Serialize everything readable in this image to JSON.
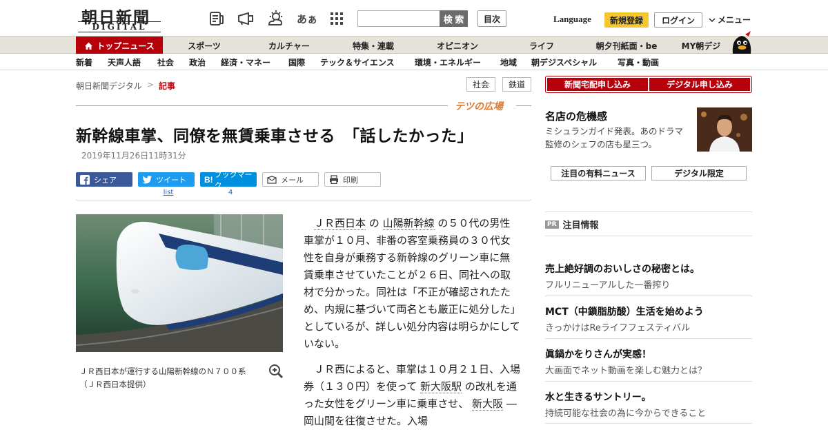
{
  "header": {
    "logo": "朝日新聞",
    "logo_sub": "DIGITAL",
    "search_placeholder": "",
    "search_button": "検 索",
    "toc_button": "目次",
    "language": "Language",
    "signup": "新規登録",
    "login": "ログイン",
    "menu": "メニュー",
    "icons": [
      "newspaper-icon",
      "megaphone-icon",
      "weather-icon",
      "font-size-icon",
      "grid-icon"
    ],
    "font_icon_text": "あぁ"
  },
  "nav_main": {
    "top": "トップニュース",
    "items": [
      "スポーツ",
      "カルチャー",
      "特集・連載",
      "オピニオン",
      "ライフ",
      "朝夕刊紙面・be",
      "MY朝デジ"
    ]
  },
  "nav_sub": [
    "新着",
    "天声人語",
    "社会",
    "政治",
    "経済・マネー",
    "国際",
    "テック＆サイエンス",
    "環境・エネルギー",
    "地域",
    "朝デジスペシャル",
    "写真・動画"
  ],
  "breadcrumb": {
    "home": "朝日新聞デジタル",
    "sep": ">",
    "current": "記事"
  },
  "tags": [
    "社会",
    "鉄道"
  ],
  "section_banner": "テツの広場",
  "article": {
    "title": "新幹線車掌、同僚を無賃乗車させる　「話したかった」",
    "date": "2019年11月26日11時31分",
    "share": {
      "facebook": "シェア",
      "twitter": "ツイート",
      "twitter_count": "list",
      "hatena": "ブックマーク",
      "hatena_count": "4",
      "mail": "メール",
      "print": "印刷"
    },
    "photo_caption": "ＪＲ西日本が運行する山陽新幹線のＮ７００系（ＪＲ西日本提供）",
    "p1": {
      "link1": "ＪＲ西日本",
      "mid1": " の ",
      "link2": "山陽新幹線",
      "rest": " の５０代の男性車掌が１０月、非番の客室乗務員の３０代女性を自身が乗務する新幹線のグリーン車に無賃乗車させていたことが２６日、同社への取材で分かった。同社は「不正が確認されたため、内規に基づいて両名とも厳正に処分した」としているが、詳しい処分内容は明らかにしていない。"
    },
    "p2": {
      "start": "ＪＲ西によると、車掌は１０月２１日、入場券（１３０円）を使って ",
      "link1": "新大阪駅",
      "mid1": " の改札を通った女性をグリーン車に乗車させ、 ",
      "link2": "新大阪",
      "rest": " ―岡山間を往復させた。入場"
    }
  },
  "sidebar": {
    "subscribe_print": "新聞宅配申し込み",
    "subscribe_digital": "デジタル申し込み",
    "promo_title": "名店の危機感",
    "promo_desc": "ミシュランガイド発表。あのドラマ監修のシェフの店も星三つ。",
    "pill_paid": "注目の有料ニュース",
    "pill_digital": "デジタル限定",
    "pr_badge": "PR",
    "pr_heading": "注目情報",
    "pr_items": [
      {
        "title": "売上絶好調のおいしさの秘密とは。",
        "sub": "フルリニューアルした一番搾り"
      },
      {
        "title": "MCT（中鎖脂肪酸）生活を始めよう",
        "sub": "きっかけはReライフフェスティバル"
      },
      {
        "title": "眞鍋かをりさんが実感！",
        "sub": "大画面でネット動画を楽しむ魅力とは？"
      },
      {
        "title": "水と生きるサントリー。",
        "sub": "持続可能な社会の為に今からできること"
      }
    ]
  },
  "colors": {
    "brand_red": "#b8000b",
    "nav_bg": "#e5e2da",
    "banner_orange": "#e0772a",
    "signup_yellow": "#f6c630"
  }
}
